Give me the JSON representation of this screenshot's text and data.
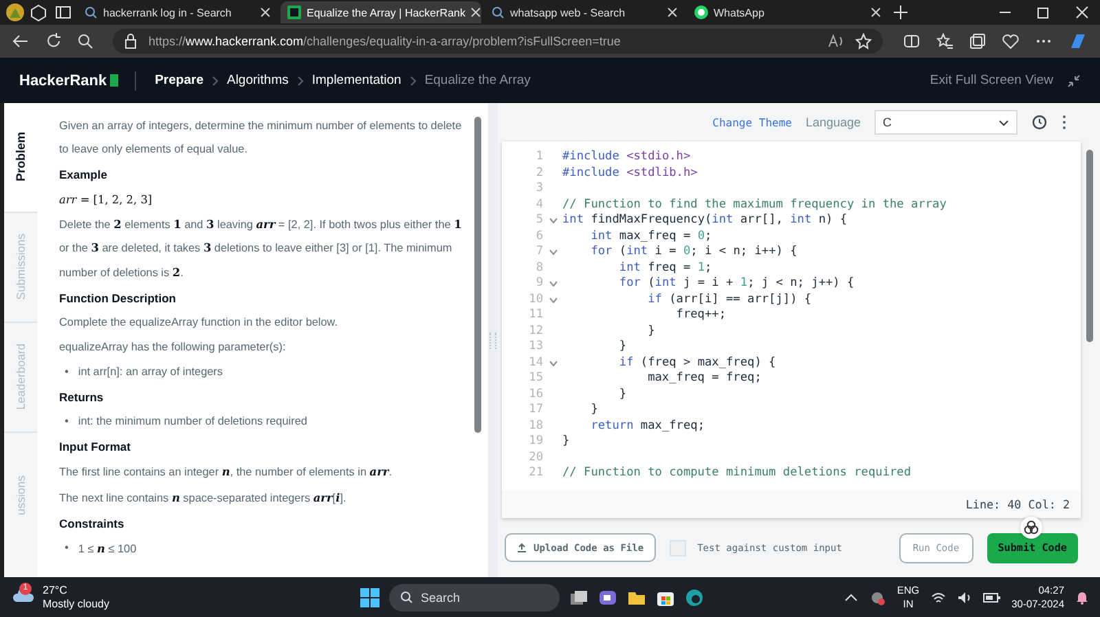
{
  "browser": {
    "tabs": [
      {
        "title": "hackerrank log in - Search",
        "kind": "search",
        "selected": false
      },
      {
        "title": "Equalize the Array | HackerRank",
        "kind": "hackerrank",
        "selected": true
      },
      {
        "title": "whatsapp web - Search",
        "kind": "search",
        "selected": false
      },
      {
        "title": "WhatsApp",
        "kind": "whatsapp",
        "selected": false
      }
    ],
    "url": "https://**www.hackerrank.com**/challenges/equality-in-a-array/problem?isFullScreen=true"
  },
  "header": {
    "logo": "HackerRank",
    "breadcrumbs": [
      {
        "label": "Prepare",
        "bold": true,
        "current": false
      },
      {
        "label": "Algorithms",
        "bold": false,
        "current": false
      },
      {
        "label": "Implementation",
        "bold": false,
        "current": false
      },
      {
        "label": "Equalize the Array",
        "bold": false,
        "current": true
      }
    ],
    "exit": "Exit Full Screen View"
  },
  "side_tabs": [
    {
      "label": "Problem",
      "selected": true
    },
    {
      "label": "Submissions",
      "selected": false
    },
    {
      "label": "Leaderboard",
      "selected": false
    },
    {
      "label": "ussions",
      "selected": false
    }
  ],
  "problem": [
    {
      "kind": "paragraph",
      "text": "Given an array of integers, determine the minimum number of elements to delete to leave only elements of equal value."
    },
    {
      "kind": "heading",
      "text": "Example"
    },
    {
      "kind": "math",
      "text": "*arr* = [1, 2, 2, 3]"
    },
    {
      "kind": "paragraph",
      "text": "Delete the **2** elements **1** and **3** leaving *arr* = [2, 2]. If both twos plus either the **1** or the **3** are deleted, it takes **3** deletions to leave either [3] or [1]. The minimum number of deletions is **2**."
    },
    {
      "kind": "heading",
      "text": "Function Description"
    },
    {
      "kind": "paragraph",
      "text": "Complete the equalizeArray function in the editor below."
    },
    {
      "kind": "paragraph",
      "text": "equalizeArray has the following parameter(s):"
    },
    {
      "kind": "bullets",
      "bullet": "•",
      "items": [
        "int arr[n]: an array of integers"
      ]
    },
    {
      "kind": "heading",
      "text": "Returns"
    },
    {
      "kind": "bullets",
      "bullet": "•",
      "items": [
        "int: the minimum number of deletions required"
      ]
    },
    {
      "kind": "heading",
      "text": "Input Format"
    },
    {
      "kind": "paragraph",
      "text": "The first line contains an integer *n*, the number of elements in *arr*."
    },
    {
      "kind": "paragraph",
      "text": "The next line contains *n* space-separated integers *arr*[*i*]."
    },
    {
      "kind": "heading",
      "text": "Constraints"
    },
    {
      "kind": "bullets",
      "bullet": "•",
      "items": [
        "1 ≤ *n* ≤ 100"
      ]
    }
  ],
  "editor": {
    "change_theme": "Change Theme",
    "language_label": "Language",
    "language": "C",
    "lines": [
      {
        "number": "1",
        "fold": false,
        "tokens": [
          {
            "kind": "keyword",
            "text": "#include "
          },
          {
            "kind": "string",
            "text": "<stdio.h>"
          }
        ]
      },
      {
        "number": "2",
        "fold": false,
        "tokens": [
          {
            "kind": "keyword",
            "text": "#include "
          },
          {
            "kind": "string",
            "text": "<stdlib.h>"
          }
        ]
      },
      {
        "number": "3",
        "fold": false
      },
      {
        "number": "4",
        "fold": false,
        "tokens": [
          {
            "kind": "comment",
            "text": "// Function to find the maximum frequency in the array"
          }
        ]
      },
      {
        "number": "5",
        "fold": true,
        "tokens": [
          {
            "kind": "keyword",
            "text": "int"
          },
          {
            "kind": "plain",
            "text": " findMaxFrequency("
          },
          {
            "kind": "keyword",
            "text": "int"
          },
          {
            "kind": "plain",
            "text": " arr[], "
          },
          {
            "kind": "keyword",
            "text": "int"
          },
          {
            "kind": "plain",
            "text": " n) {"
          }
        ]
      },
      {
        "number": "6",
        "fold": false,
        "tokens": [
          {
            "kind": "keyword",
            "text": "    int"
          },
          {
            "kind": "plain",
            "text": " max_freq = "
          },
          {
            "kind": "number",
            "text": "0"
          },
          {
            "kind": "plain",
            "text": ";"
          }
        ]
      },
      {
        "number": "7",
        "fold": true,
        "tokens": [
          {
            "kind": "keyword",
            "text": "    for"
          },
          {
            "kind": "plain",
            "text": " ("
          },
          {
            "kind": "keyword",
            "text": "int"
          },
          {
            "kind": "plain",
            "text": " i = "
          },
          {
            "kind": "number",
            "text": "0"
          },
          {
            "kind": "plain",
            "text": "; i < n; i++) {"
          }
        ]
      },
      {
        "number": "8",
        "fold": false,
        "tokens": [
          {
            "kind": "keyword",
            "text": "        int"
          },
          {
            "kind": "plain",
            "text": " freq = "
          },
          {
            "kind": "number",
            "text": "1"
          },
          {
            "kind": "plain",
            "text": ";"
          }
        ]
      },
      {
        "number": "9",
        "fold": true,
        "tokens": [
          {
            "kind": "keyword",
            "text": "        for"
          },
          {
            "kind": "plain",
            "text": " ("
          },
          {
            "kind": "keyword",
            "text": "int"
          },
          {
            "kind": "plain",
            "text": " j = i + "
          },
          {
            "kind": "number",
            "text": "1"
          },
          {
            "kind": "plain",
            "text": "; j < n; j++) {"
          }
        ]
      },
      {
        "number": "10",
        "fold": true,
        "tokens": [
          {
            "kind": "keyword",
            "text": "            if"
          },
          {
            "kind": "plain",
            "text": " (arr[i] == arr[j]) {"
          }
        ]
      },
      {
        "number": "11",
        "fold": false,
        "tokens": [
          {
            "kind": "plain",
            "text": "                freq++;"
          }
        ]
      },
      {
        "number": "12",
        "fold": false,
        "tokens": [
          {
            "kind": "plain",
            "text": "            }"
          }
        ]
      },
      {
        "number": "13",
        "fold": false,
        "tokens": [
          {
            "kind": "plain",
            "text": "        }"
          }
        ]
      },
      {
        "number": "14",
        "fold": true,
        "tokens": [
          {
            "kind": "keyword",
            "text": "        if"
          },
          {
            "kind": "plain",
            "text": " (freq > max_freq) {"
          }
        ]
      },
      {
        "number": "15",
        "fold": false,
        "tokens": [
          {
            "kind": "plain",
            "text": "            max_freq = freq;"
          }
        ]
      },
      {
        "number": "16",
        "fold": false,
        "tokens": [
          {
            "kind": "plain",
            "text": "        }"
          }
        ]
      },
      {
        "number": "17",
        "fold": false,
        "tokens": [
          {
            "kind": "plain",
            "text": "    }"
          }
        ]
      },
      {
        "number": "18",
        "fold": false,
        "tokens": [
          {
            "kind": "keyword",
            "text": "    return"
          },
          {
            "kind": "plain",
            "text": " max_freq;"
          }
        ]
      },
      {
        "number": "19",
        "fold": false,
        "tokens": [
          {
            "kind": "plain",
            "text": "}"
          }
        ]
      },
      {
        "number": "20",
        "fold": false
      },
      {
        "number": "21",
        "fold": false,
        "tokens": [
          {
            "kind": "comment",
            "text": "// Function to compute minimum deletions required"
          }
        ]
      }
    ],
    "status": "Line: 40 Col: 2",
    "upload": "Upload Code as File",
    "custom_input": {
      "label": "Test against custom input",
      "checked": false
    },
    "run": {
      "label": "Run Code",
      "disabled": true
    },
    "submit": "Submit Code"
  },
  "taskbar": {
    "weather_badge": "1",
    "temperature": "27°C",
    "weather": "Mostly cloudy",
    "search": "Search",
    "language": "ENG",
    "region": "IN",
    "time": "04:27",
    "date": "30-07-2024"
  }
}
